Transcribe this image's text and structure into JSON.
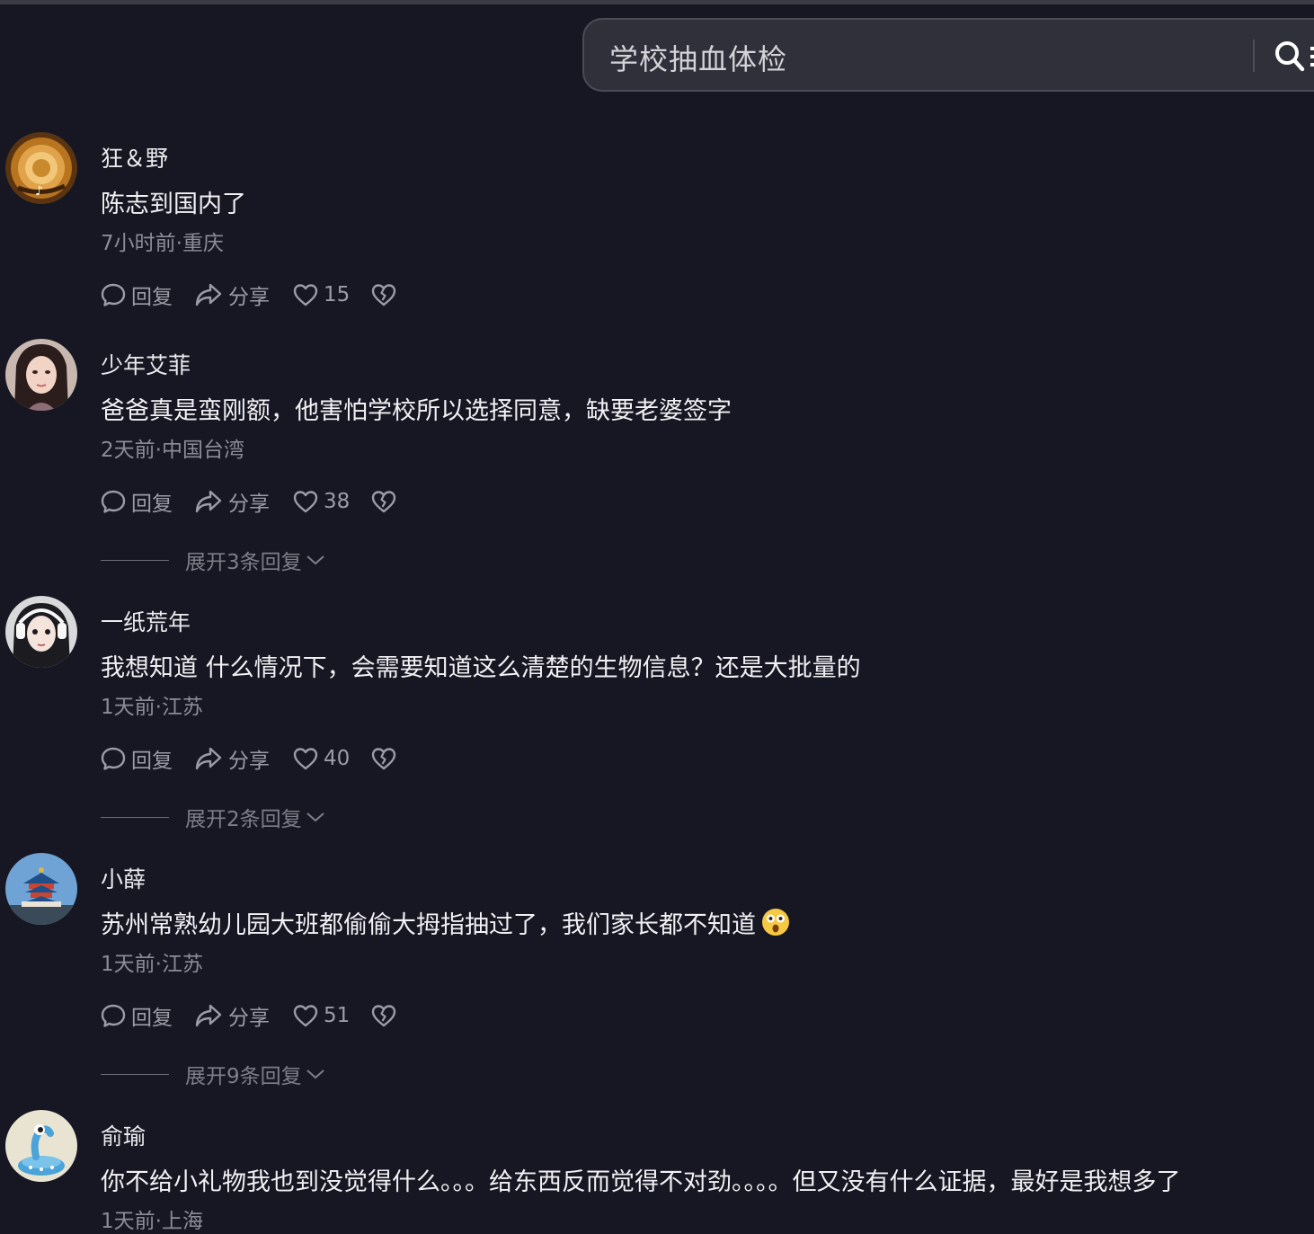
{
  "search": {
    "query": "学校抽血体检"
  },
  "colors": {
    "background": "#161722",
    "search_bg": "#2f3039",
    "muted_text": "#8b8c96"
  },
  "comments": [
    {
      "username": "狂＆野",
      "text": "陈志到国内了",
      "meta": "7小时前·重庆",
      "actions": {
        "reply": "回复",
        "share": "分享",
        "likes": "15"
      },
      "avatar_icon": "gold-watch-avatar"
    },
    {
      "username": "少年艾菲",
      "text": "爸爸真是蛮刚额，他害怕学校所以选择同意，缺要老婆签字",
      "meta": "2天前·中国台湾",
      "actions": {
        "reply": "回复",
        "share": "分享",
        "likes": "38"
      },
      "expand": "展开3条回复",
      "avatar_icon": "girl-portrait-avatar"
    },
    {
      "username": "一纸荒年",
      "text": "我想知道 什么情况下，会需要知道这么清楚的生物信息？还是大批量的",
      "meta": "1天前·江苏",
      "actions": {
        "reply": "回复",
        "share": "分享",
        "likes": "40"
      },
      "expand": "展开2条回复",
      "avatar_icon": "anime-girl-headphones-avatar"
    },
    {
      "username": "小薛",
      "text": "苏州常熟幼儿园大班都偷偷大拇指抽过了，我们家长都不知道",
      "meta": "1天前·江苏",
      "actions": {
        "reply": "回复",
        "share": "分享",
        "likes": "51"
      },
      "expand": "展开9条回复",
      "avatar_icon": "temple-of-heaven-avatar"
    },
    {
      "username": "俞瑜",
      "text": "你不给小礼物我也到没觉得什么。。。给东西反而觉得不对劲。。。。但又没有什么证据，最好是我想多了",
      "meta": "1天前·上海",
      "avatar_icon": "cartoon-alien-avatar"
    }
  ]
}
